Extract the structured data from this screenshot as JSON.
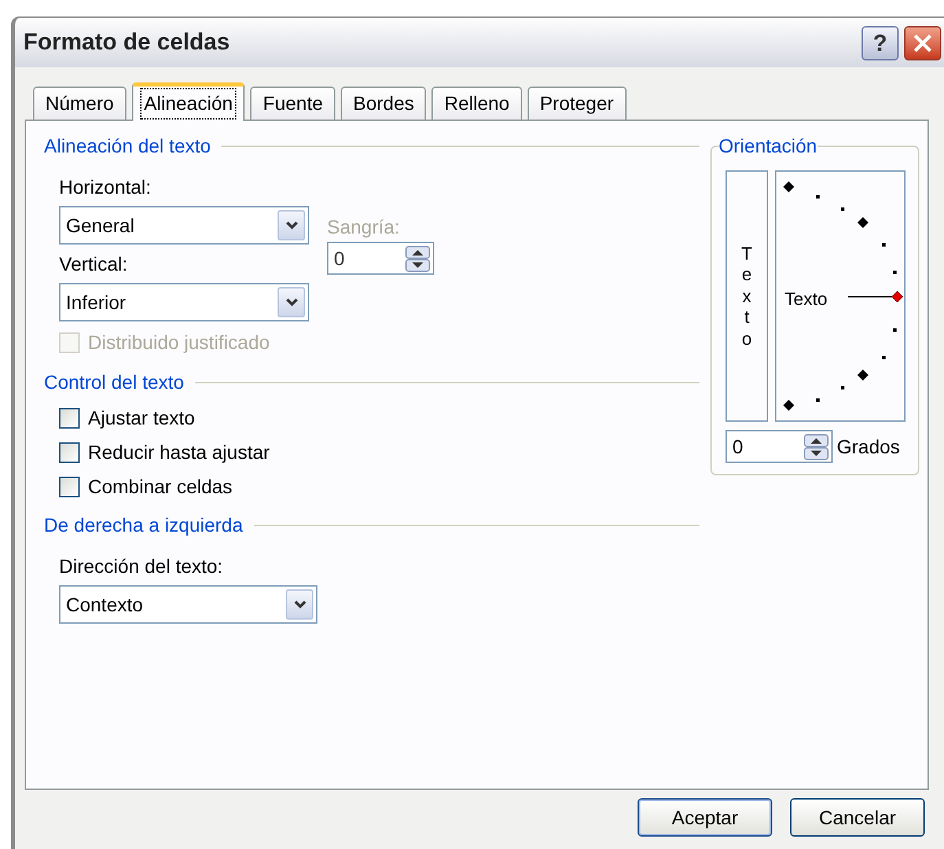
{
  "window": {
    "title": "Formato de celdas",
    "help_button": "?"
  },
  "tabs": [
    {
      "label": "Número",
      "selected": false
    },
    {
      "label": "Alineación",
      "selected": true
    },
    {
      "label": "Fuente",
      "selected": false
    },
    {
      "label": "Bordes",
      "selected": false
    },
    {
      "label": "Relleno",
      "selected": false
    },
    {
      "label": "Proteger",
      "selected": false
    }
  ],
  "text_alignment": {
    "title": "Alineación del texto",
    "horizontal": {
      "label": "Horizontal:",
      "value": "General"
    },
    "vertical": {
      "label": "Vertical:",
      "value": "Inferior"
    },
    "indent": {
      "label": "Sangría:",
      "value": "0",
      "disabled": true
    },
    "distributed": {
      "label": "Distribuido justificado",
      "checked": false,
      "disabled": true
    }
  },
  "text_control": {
    "title": "Control del texto",
    "options": [
      {
        "label": "Ajustar texto",
        "checked": false
      },
      {
        "label": "Reducir hasta ajustar",
        "checked": false
      },
      {
        "label": "Combinar celdas",
        "checked": false
      }
    ]
  },
  "right_to_left": {
    "title": "De derecha a izquierda",
    "direction": {
      "label": "Dirección del texto:",
      "value": "Contexto"
    }
  },
  "orientation": {
    "title": "Orientación",
    "vertical_text": "Texto",
    "dial_text": "Texto",
    "degrees": {
      "value": "0",
      "label": "Grados"
    }
  },
  "buttons": [
    "Aceptar",
    "Cancelar"
  ]
}
